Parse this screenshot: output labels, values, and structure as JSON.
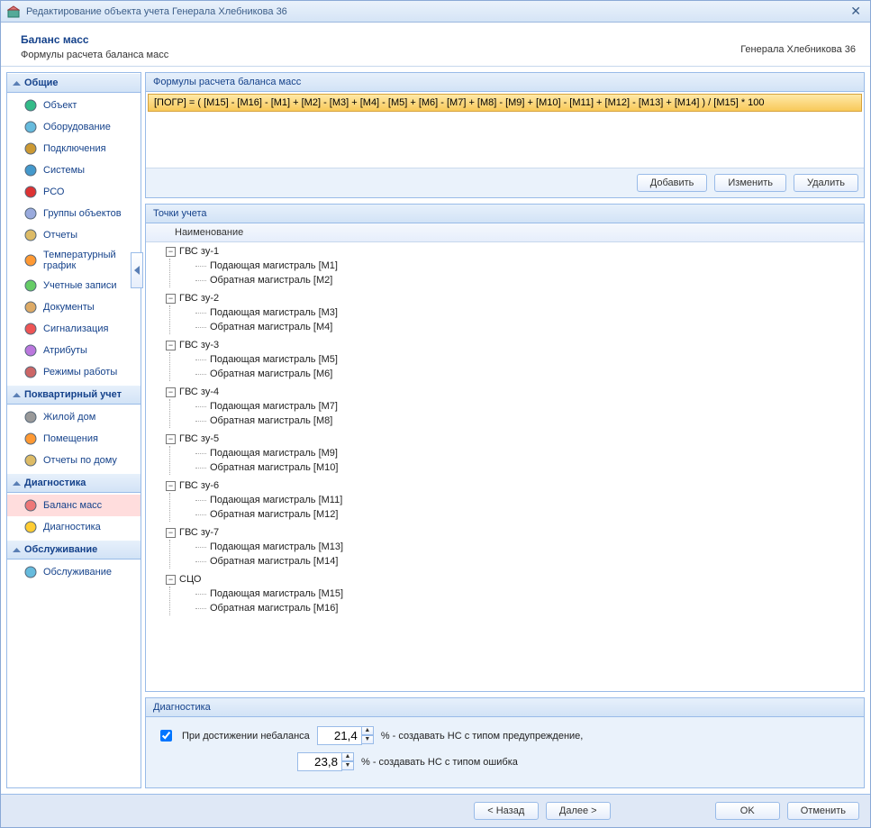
{
  "window": {
    "title": "Редактирование объекта учета Генерала Хлебникова 36"
  },
  "header": {
    "title": "Баланс масс",
    "subtitle": "Формулы расчета баланса масс",
    "right": "Генерала Хлебникова 36"
  },
  "sidebar": [
    {
      "title": "Общие",
      "items": [
        {
          "label": "Объект"
        },
        {
          "label": "Оборудование"
        },
        {
          "label": "Подключения"
        },
        {
          "label": "Системы"
        },
        {
          "label": "РСО"
        },
        {
          "label": "Группы объектов"
        },
        {
          "label": "Отчеты"
        },
        {
          "label": "Температурный график"
        },
        {
          "label": "Учетные записи"
        },
        {
          "label": "Документы"
        },
        {
          "label": "Сигнализация"
        },
        {
          "label": "Атрибуты"
        },
        {
          "label": "Режимы работы"
        }
      ]
    },
    {
      "title": "Поквартирный учет",
      "items": [
        {
          "label": "Жилой дом"
        },
        {
          "label": "Помещения"
        },
        {
          "label": "Отчеты по дому"
        }
      ]
    },
    {
      "title": "Диагностика",
      "items": [
        {
          "label": "Баланс масс",
          "selected": true
        },
        {
          "label": "Диагностика"
        }
      ]
    },
    {
      "title": "Обслуживание",
      "items": [
        {
          "label": "Обслуживание"
        }
      ]
    }
  ],
  "sidebar_icons": [
    [
      "#3b8",
      "#6bd",
      "#c93",
      "#49c",
      "#d33",
      "#9ad",
      "#db6",
      "#f93",
      "#6c6",
      "#da6",
      "#e55",
      "#b7d",
      "#c66"
    ],
    [
      "#999",
      "#f93",
      "#db6"
    ],
    [
      "#e77",
      "#fc3"
    ],
    [
      "#6bd"
    ]
  ],
  "formulas": {
    "title": "Формулы расчета баланса масс",
    "row": "[ПОГР] = ( [М15] - [М16] - [М1] + [М2] - [М3] + [М4] - [М5] + [М6] - [М7] + [М8] - [М9] + [М10] - [М11] + [М12] - [М13] + [М14] ) / [М15] * 100",
    "buttons": {
      "add": "Добавить",
      "edit": "Изменить",
      "delete": "Удалить"
    }
  },
  "points": {
    "title": "Точки учета",
    "header": "Наименование",
    "nodes": [
      {
        "name": "ГВС зу-1",
        "children": [
          {
            "name": "Подающая магистраль [М1]"
          },
          {
            "name": "Обратная магистраль [М2]"
          }
        ]
      },
      {
        "name": "ГВС зу-2",
        "children": [
          {
            "name": "Подающая магистраль [М3]"
          },
          {
            "name": "Обратная магистраль [М4]"
          }
        ]
      },
      {
        "name": "ГВС зу-3",
        "children": [
          {
            "name": "Подающая магистраль [М5]"
          },
          {
            "name": "Обратная магистраль [М6]"
          }
        ]
      },
      {
        "name": "ГВС зу-4",
        "children": [
          {
            "name": "Подающая магистраль [М7]"
          },
          {
            "name": "Обратная магистраль [М8]"
          }
        ]
      },
      {
        "name": "ГВС зу-5",
        "children": [
          {
            "name": "Подающая магистраль [М9]"
          },
          {
            "name": "Обратная магистраль [М10]"
          }
        ]
      },
      {
        "name": "ГВС зу-6",
        "children": [
          {
            "name": "Подающая магистраль [М11]"
          },
          {
            "name": "Обратная магистраль [М12]"
          }
        ]
      },
      {
        "name": "ГВС зу-7",
        "children": [
          {
            "name": "Подающая магистраль [М13]"
          },
          {
            "name": "Обратная магистраль [М14]"
          }
        ]
      },
      {
        "name": "СЦО",
        "children": [
          {
            "name": "Подающая магистраль [М15]"
          },
          {
            "name": "Обратная магистраль [М16]"
          }
        ]
      }
    ]
  },
  "diag": {
    "title": "Диагностика",
    "check_label": "При достижении небаланса",
    "warn_value": "21,4",
    "warn_suffix": "% - создавать НС с типом предупреждение,",
    "err_value": "23,8",
    "err_suffix": "% - создавать НС с типом ошибка"
  },
  "footer": {
    "back": "< Назад",
    "next": "Далее >",
    "ok": "OK",
    "cancel": "Отменить"
  }
}
